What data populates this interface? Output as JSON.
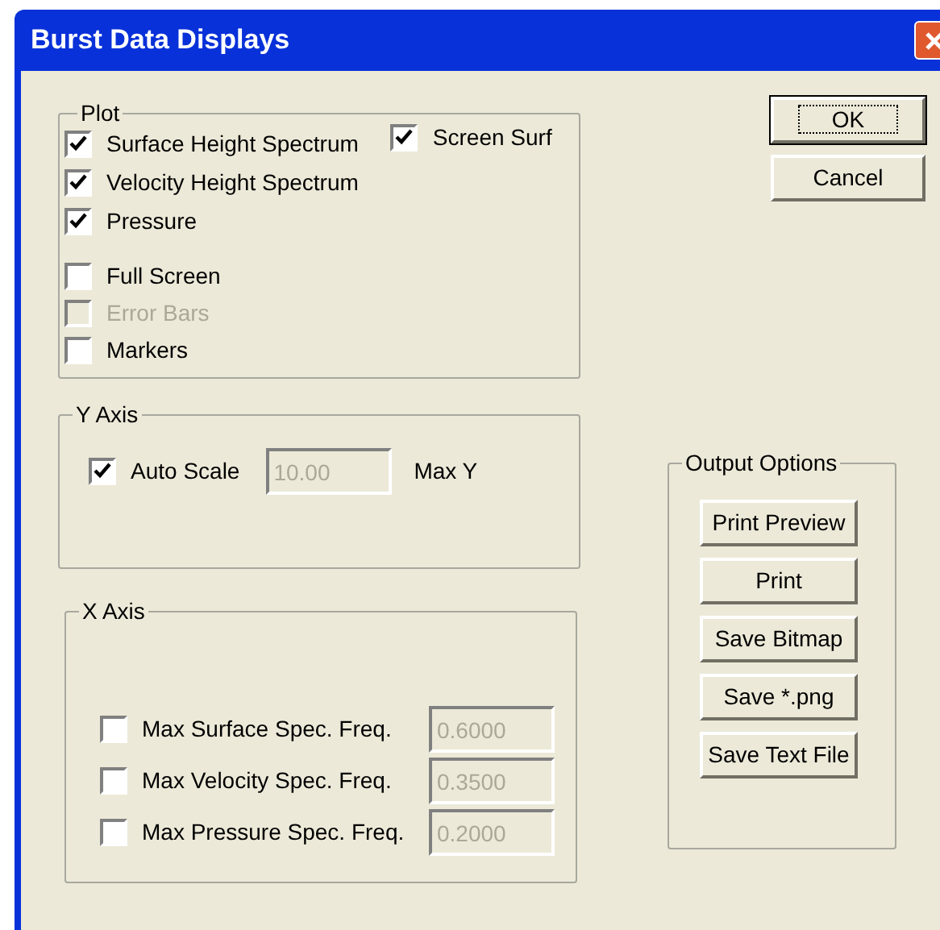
{
  "window": {
    "title": "Burst Data Displays"
  },
  "plot": {
    "label": "Plot",
    "spectra": [
      {
        "label": "Surface Height Spectrum",
        "checked": true,
        "disabled": false
      },
      {
        "label": "Velocity Height Spectrum",
        "checked": true,
        "disabled": false
      },
      {
        "label": "Pressure",
        "checked": true,
        "disabled": false
      }
    ],
    "display": [
      {
        "label": "Full Screen",
        "checked": false,
        "disabled": false
      },
      {
        "label": "Error Bars",
        "checked": false,
        "disabled": true
      },
      {
        "label": "Markers",
        "checked": false,
        "disabled": false
      }
    ],
    "screen_surf": {
      "label": "Screen Surf",
      "checked": true,
      "disabled": false
    }
  },
  "dialog_buttons": [
    {
      "label": "OK",
      "default": true
    },
    {
      "label": "Cancel",
      "default": false
    }
  ],
  "y_axis": {
    "label": "Y Axis",
    "auto_scale": {
      "label": "Auto Scale",
      "checked": true,
      "disabled": false
    },
    "max_y": {
      "value": "10.00",
      "disabled": true
    },
    "max_y_label": "Max Y"
  },
  "x_axis": {
    "label": "X Axis",
    "rows": [
      {
        "label": "Max Surface Spec. Freq.",
        "checked": false,
        "value": "0.6000",
        "disabled": true
      },
      {
        "label": "Max Velocity Spec. Freq.",
        "checked": false,
        "value": "0.3500",
        "disabled": true
      },
      {
        "label": "Max Pressure Spec. Freq.",
        "checked": false,
        "value": "0.2000",
        "disabled": true
      }
    ]
  },
  "output_options": {
    "label": "Output Options",
    "buttons": [
      "Print Preview",
      "Print",
      "Save Bitmap",
      "Save *.png",
      "Save Text File"
    ]
  }
}
